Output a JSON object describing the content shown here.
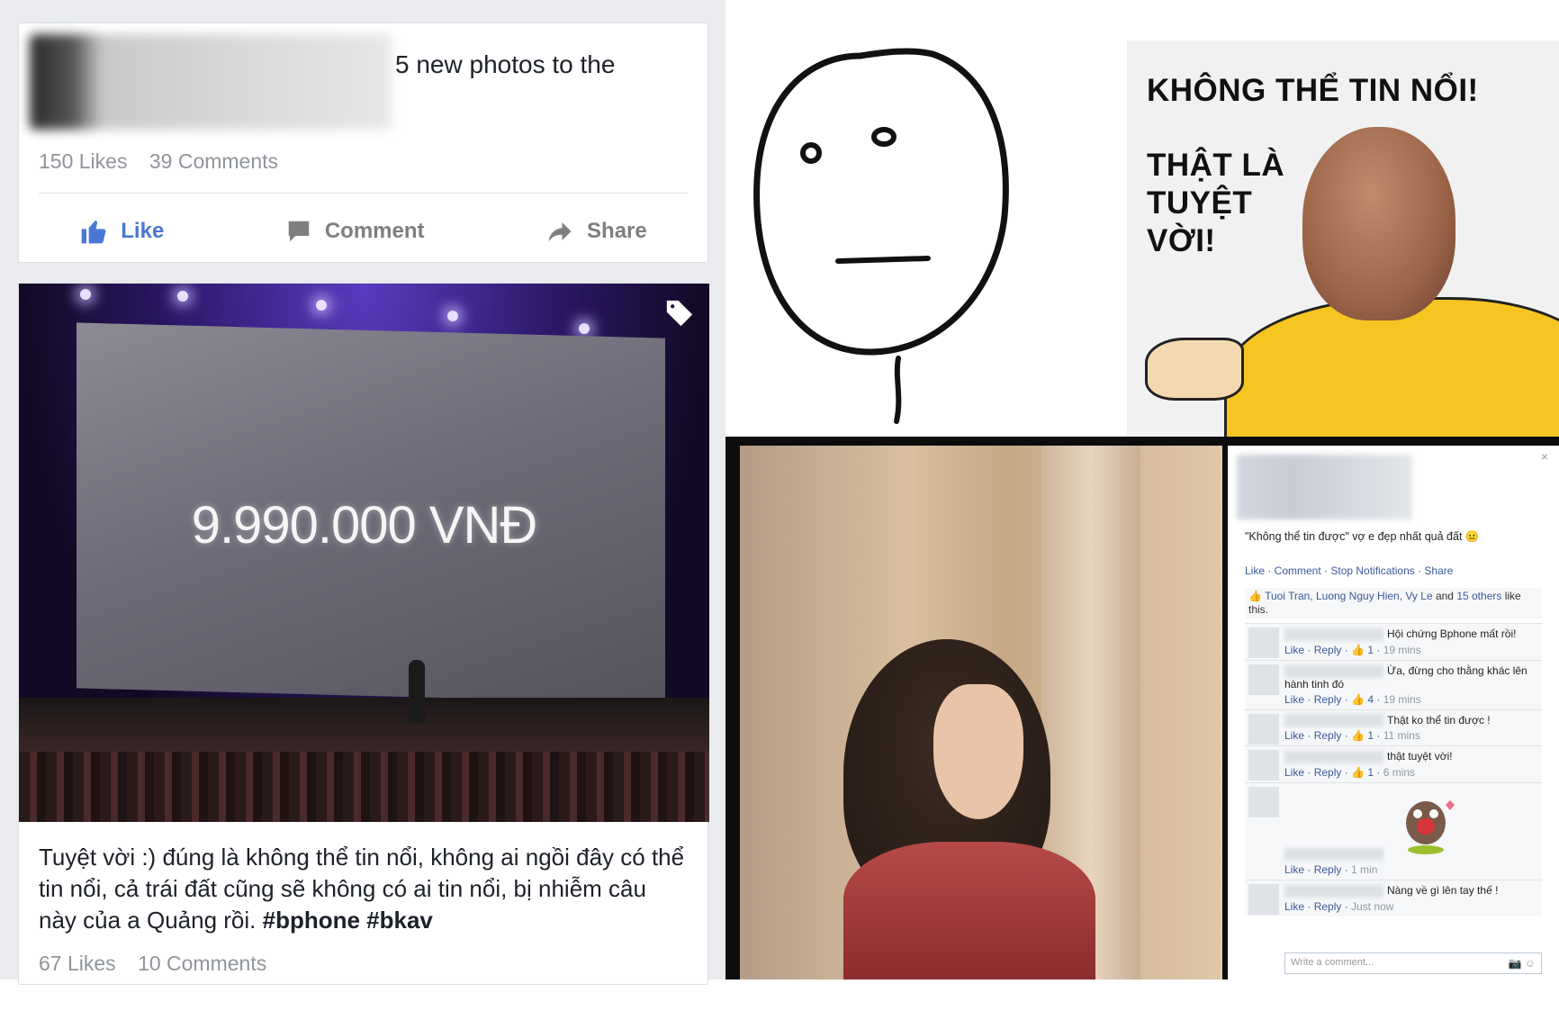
{
  "post1": {
    "header_text": "5 new photos to the",
    "likes": "150 Likes",
    "comments": "39 Comments",
    "actions": {
      "like": "Like",
      "comment": "Comment",
      "share": "Share"
    }
  },
  "post2": {
    "price_on_screen": "9.990.000 VNĐ",
    "caption_text": "Tuyệt vời :) đúng là không thể tin nổi, không ai ngồi đây có thể tin nổi, cả trái đất cũng sẽ không có ai tin nổi, bị nhiễm câu này của a Quảng rồi. ",
    "hashtags": "#bphone #bkav",
    "likes": "67 Likes",
    "comments": "10 Comments"
  },
  "meme": {
    "title": "KHÔNG THỂ TIN NỔI!",
    "line1": "THẬT LÀ",
    "line2": "TUYỆT",
    "line3": "VỜI!"
  },
  "fb_comments": {
    "close": "×",
    "status": "\"Không thể tin được\" vợ e đẹp nhất quả đất 😐",
    "links": "Like · Comment · Stop Notifications · Share",
    "likers_names": "Tuoi Tran, Luong Nguy Hien, Vy Le",
    "likers_and": " and ",
    "likers_others": "15 others",
    "likers_suffix": " like this.",
    "comments": [
      {
        "text": "Hội chứng Bphone mất rồi!",
        "like": "Like",
        "reply": "Reply",
        "count": "1",
        "time": "19 mins"
      },
      {
        "text": "Ừa, đừng cho thằng khác lên hành tinh đó",
        "like": "Like",
        "reply": "Reply",
        "count": "4",
        "time": "19 mins"
      },
      {
        "text": "Thật ko thể tin được !",
        "like": "Like",
        "reply": "Reply",
        "count": "1",
        "time": "11 mins"
      },
      {
        "text": "thật tuyệt vời!",
        "like": "Like",
        "reply": "Reply",
        "count": "1",
        "time": "6 mins"
      },
      {
        "text": "",
        "like": "Like",
        "reply": "Reply",
        "count": "",
        "time": "1 min"
      },
      {
        "text": "Nàng về gì lên tay thế !",
        "like": "Like",
        "reply": "Reply",
        "count": "",
        "time": "Just now"
      }
    ],
    "write_placeholder": "Write a comment..."
  },
  "colors": {
    "fb_blue": "#3b5998",
    "like_blue": "#4a77d4",
    "shirt_yellow": "#f6c521"
  }
}
